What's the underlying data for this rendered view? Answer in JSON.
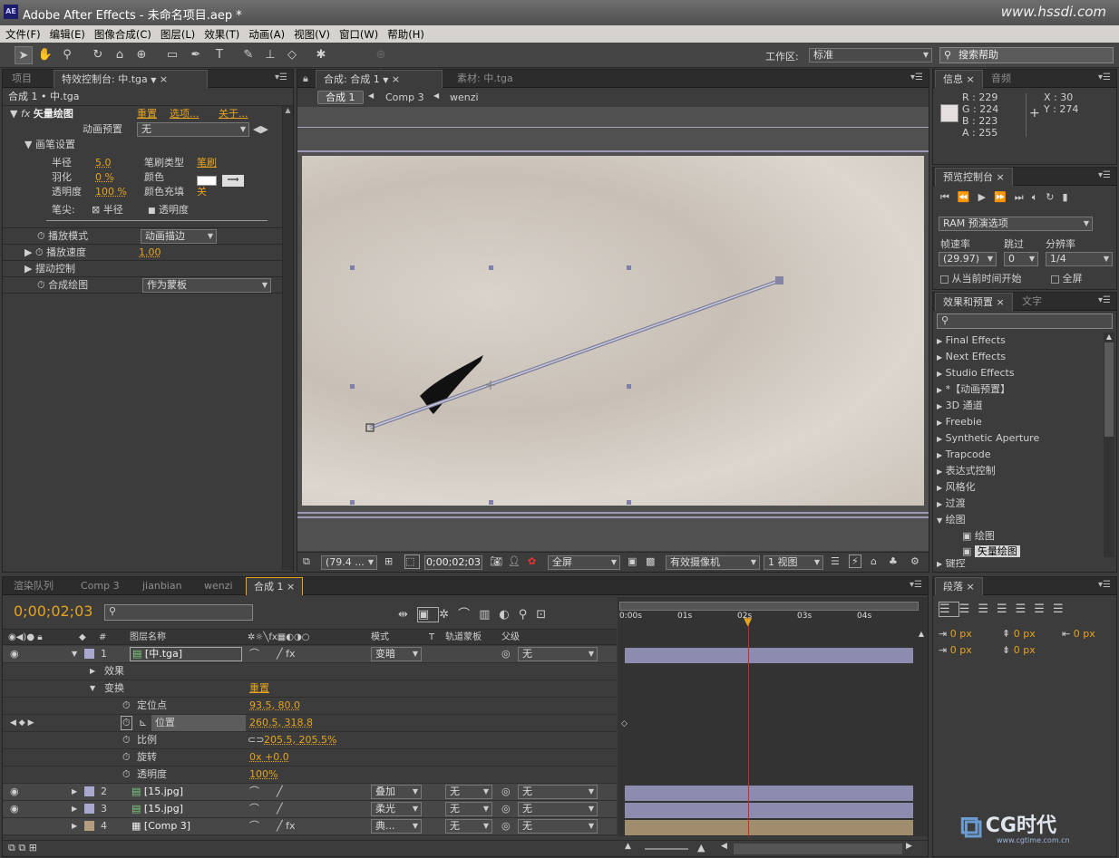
{
  "titlebar": {
    "app_icon": "AE",
    "title": "Adobe After Effects - 未命名项目.aep *",
    "watermark": "www.hssdi.com"
  },
  "menu": [
    "文件(F)",
    "编辑(E)",
    "图像合成(C)",
    "图层(L)",
    "效果(T)",
    "动画(A)",
    "视图(V)",
    "窗口(W)",
    "帮助(H)"
  ],
  "toolbar": {
    "workspace_label": "工作区:",
    "workspace_value": "标准",
    "search_placeholder": "搜索帮助"
  },
  "effect_panel": {
    "tabs": [
      "项目",
      "特效控制台: 中.tga"
    ],
    "breadcrumb": "合成 1 • 中.tga",
    "effect_name": "矢量绘图",
    "reset": "重置",
    "options": "选项...",
    "about": "关于...",
    "preset_label": "动画预置",
    "preset_value": "无",
    "brush_settings": "画笔设置",
    "radius_label": "半径",
    "radius_value": "5.0",
    "brush_type_label": "笔刷类型",
    "brush_type_value": "笔刷",
    "feather_label": "羽化",
    "feather_value": "0 %",
    "color_label": "颜色",
    "opacity_label": "透明度",
    "opacity_value": "100 %",
    "color_fill_label": "颜色充填",
    "color_fill_value": "关",
    "tip_label": "笔尖:",
    "tip_radius": "半径",
    "tip_opacity": "透明度",
    "playback_mode_label": "播放模式",
    "playback_mode_value": "动画描边",
    "playback_speed_label": "播放速度",
    "playback_speed_value": "1.00",
    "wiggle_label": "摆动控制",
    "composite_label": "合成绘图",
    "composite_value": "作为蒙板"
  },
  "comp_panel": {
    "tabs": [
      "合成: 合成 1",
      "素材: 中.tga"
    ],
    "breadcrumbs": [
      "合成 1",
      "Comp 3",
      "wenzi"
    ],
    "footer": {
      "zoom": "(79.4 ...",
      "timecode": "0;00;02;03",
      "resolution": "全屏",
      "camera": "有效摄像机",
      "view": "1 视图"
    }
  },
  "info_panel": {
    "tabs": [
      "信息",
      "音频"
    ],
    "r": "R : 229",
    "g": "G : 224",
    "b": "B : 223",
    "a": "A : 255",
    "x": "X : 30",
    "y": "Y : 274"
  },
  "preview_panel": {
    "tab": "预览控制台",
    "ram": "RAM 预演选项",
    "fps_label": "帧速率",
    "skip_label": "跳过",
    "res_label": "分辨率",
    "fps": "(29.97)",
    "skip": "0",
    "res": "1/4",
    "from_current": "从当前时间开始",
    "fullscreen": "全屏"
  },
  "effects_panel": {
    "tabs": [
      "效果和预置",
      "文字"
    ],
    "items": [
      "Final Effects",
      "Next Effects",
      "Studio Effects",
      "*【动画预置】",
      "3D 通道",
      "Freebie",
      "Synthetic Aperture",
      "Trapcode",
      "表达式控制",
      "风格化",
      "过渡",
      "绘图"
    ],
    "sub_items": [
      "绘图",
      "矢量绘图"
    ],
    "last_item": "键控"
  },
  "paragraph_panel": {
    "tab": "段落",
    "px": [
      "0 px",
      "0 px",
      "0 px",
      "0 px",
      "0 px"
    ]
  },
  "timeline": {
    "tabs": [
      "渲染队列",
      "Comp 3",
      "jianbian",
      "wenzi",
      "合成 1"
    ],
    "timecode": "0;00;02;03",
    "headers": {
      "num": "#",
      "name": "图层名称",
      "mode": "模式",
      "t": "T",
      "trkmat": "轨道蒙板",
      "parent": "父级"
    },
    "ruler": [
      "0:00s",
      "01s",
      "02s",
      "03s",
      "04s"
    ],
    "layers": [
      {
        "num": "1",
        "name": "[中.tga]",
        "mode": "变暗",
        "trk": "",
        "parent": "无"
      },
      {
        "num": "2",
        "name": "[15.jpg]",
        "mode": "叠加",
        "trk": "无",
        "parent": "无"
      },
      {
        "num": "3",
        "name": "[15.jpg]",
        "mode": "柔光",
        "trk": "无",
        "parent": "无"
      },
      {
        "num": "4",
        "name": "[Comp 3]",
        "mode": "典...",
        "trk": "无",
        "parent": "无"
      }
    ],
    "props": {
      "effects": "效果",
      "transform": "变换",
      "reset": "重置",
      "anchor_label": "定位点",
      "anchor": "93.5, 80.0",
      "position_label": "位置",
      "position": "260.5, 318.8",
      "scale_label": "比例",
      "scale": "205.5, 205.5%",
      "rotation_label": "旋转",
      "rotation": "0x +0.0",
      "opacity_label": "透明度",
      "opacity": "100%"
    }
  },
  "logo": {
    "text": "CG时代",
    "url": "www.cgtime.com.cn"
  }
}
